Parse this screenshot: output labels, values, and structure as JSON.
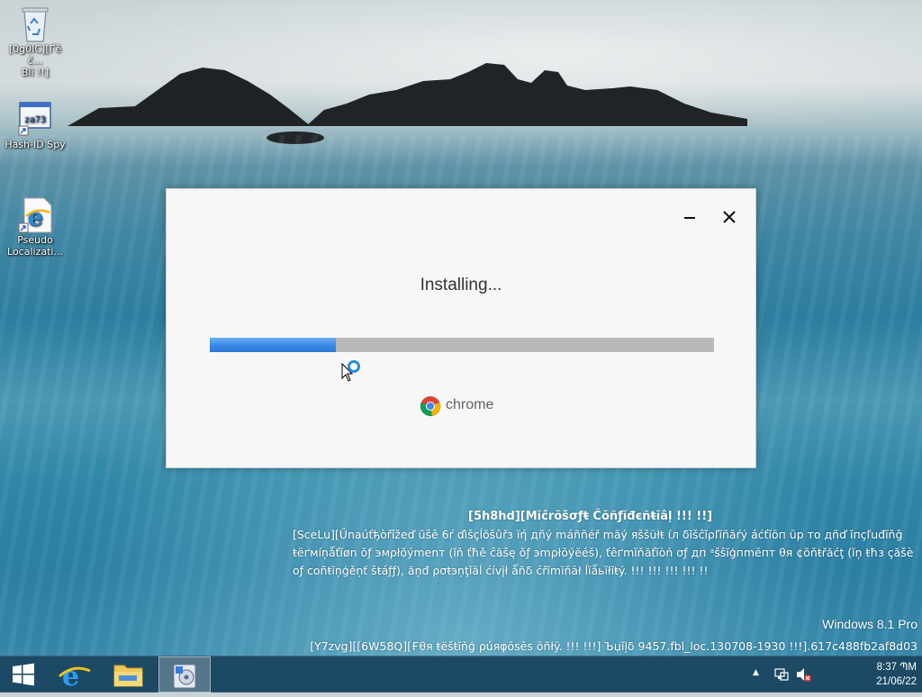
{
  "desktop": {
    "icons": [
      {
        "name": "recycle-bin",
        "label": "[0g0IC][Ґěč...\nВіи !!]"
      },
      {
        "name": "hash-id-spy",
        "label": "Hash-ID Spy"
      },
      {
        "name": "pseudo-localization",
        "label": "Pseudo\nLocalizati..."
      }
    ],
    "hash_icon_text": "za73"
  },
  "installer": {
    "title": "Installing...",
    "progress_fraction": 0.25,
    "brand": "chrome",
    "minimize_label": "—",
    "close_label": "✕"
  },
  "watermark": {
    "title": "[5h8hd][Mĭĉrŏšσƒŧ Ĉŏñƒĭđєñŧĭâļ !!! !!]",
    "body": "[SceLu][Űnaúťђòřîžeď ũšê 6ŕ ďìšçĺŏšûřз ïή дñý máññéř mãý яššüłŧ ίл δĭšĉĭρľĭñãŕý áćťĭōп ūр то дñď ĭпçľuđĭňğ ŧёґмíņǻťĭøn ŏƒ эмρłŏýmеnт (ĭň ťħě ĉăšę ŏƒ эmρłŏýëéš), ťêґmĭňăťĭòń σƒ дп ᵃšŝĭģпmēпт θя ¢ŏňŧřăćţ (ĭņ ŧħз çăšè oƒ coñŧĭņģěņť šŧáƒƒ), ăņđ ρσŧэņţĭãĺ ćívįł ǻñδ ćřĭmĭňāł ĺĭǻьĭłĭŧý. !!! !!! !!! !!! !!",
    "edition": "Windows 8.1 Pro",
    "build": "[Y7zvg][[6W58Q][Ғθя ŧëšŧĭňģ ρúяφōsēs ōñłÿ. !!! !!!] Ъџĭļδ 9457.fbl_loc.130708-1930 !!!].617c488fb2af8d03"
  },
  "taskbar": {
    "items": [
      "start-button",
      "internet-explorer",
      "file-explorer",
      "installer-app"
    ],
    "clock_time": "8:37 ՊM",
    "clock_date": "21/06/22",
    "tray_arrow": "▲"
  },
  "colors": {
    "progress": "#3c8ce7",
    "taskbar": "#14374f",
    "chrome_text": "#5f6368"
  }
}
